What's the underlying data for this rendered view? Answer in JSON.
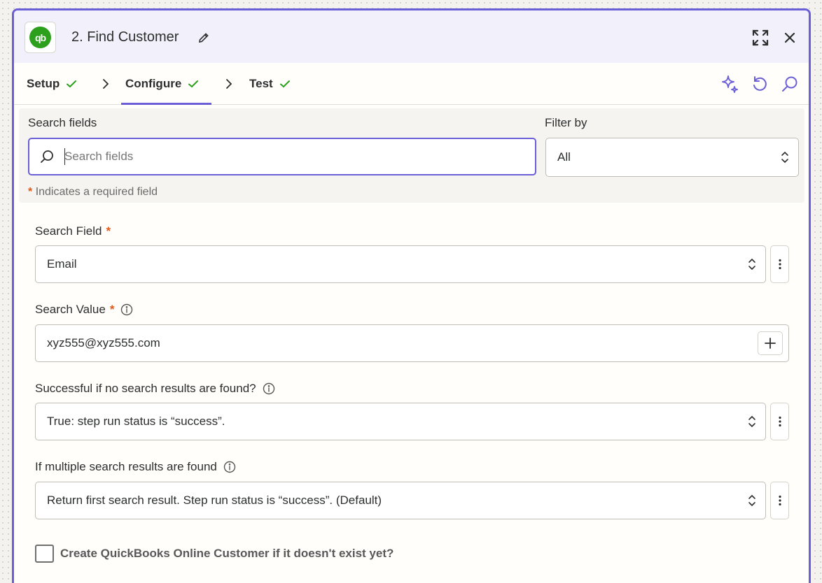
{
  "header": {
    "app_logo_text": "qb",
    "title": "2. Find Customer"
  },
  "tabs": [
    {
      "label": "Setup",
      "complete": true,
      "active": false
    },
    {
      "label": "Configure",
      "complete": true,
      "active": true
    },
    {
      "label": "Test",
      "complete": true,
      "active": false
    }
  ],
  "search": {
    "label": "Search fields",
    "placeholder": "Search fields",
    "value": ""
  },
  "filter": {
    "label": "Filter by",
    "value": "All"
  },
  "required_note": {
    "star": "*",
    "text": "Indicates a required field"
  },
  "fields": {
    "search_field": {
      "label": "Search Field",
      "required": "*",
      "value": "Email"
    },
    "search_value": {
      "label": "Search Value",
      "required": "*",
      "value": "xyz555@xyz555.com"
    },
    "success_if_none": {
      "label": "Successful if no search results are found?",
      "value": "True: step run status is “success”."
    },
    "multiple_results": {
      "label": "If multiple search results are found",
      "value": "Return first search result. Step run status is “success”. (Default)"
    },
    "create_if_missing": {
      "label": "Create QuickBooks Online Customer if it doesn't exist yet?",
      "checked": false
    }
  },
  "colors": {
    "accent": "#6a5fd6",
    "success_check": "#2ca01c",
    "required": "#e05a1a",
    "quickbooks": "#2ca01c"
  },
  "icons": [
    "quickbooks-logo",
    "pencil-icon",
    "expand-icon",
    "close-icon",
    "check-icon",
    "chevron-right-icon",
    "sparkle-icon",
    "undo-icon",
    "search-icon",
    "chevron-up-down-icon",
    "info-icon",
    "more-vertical-icon",
    "plus-icon"
  ]
}
